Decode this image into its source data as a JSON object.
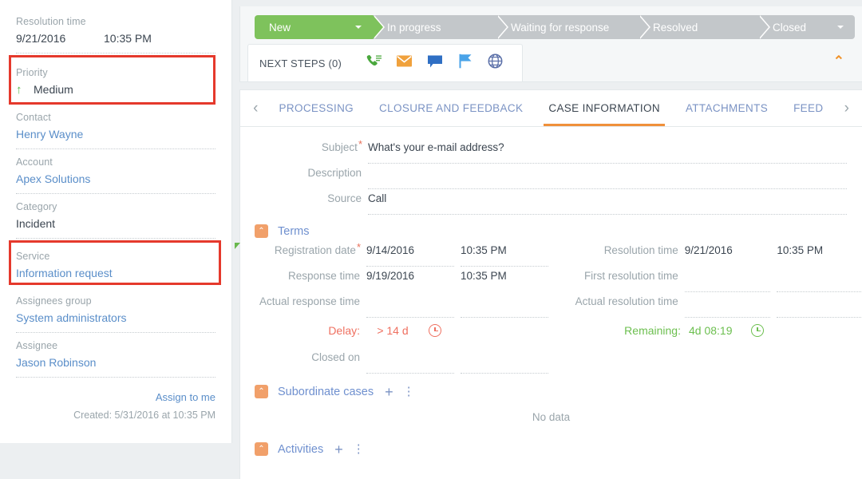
{
  "sidebar": {
    "fields": [
      {
        "label": "Resolution time",
        "value": "",
        "date": "9/21/2016",
        "time": "10:35 PM",
        "type": "datetime",
        "link": false
      },
      {
        "label": "Priority",
        "value": "Medium",
        "type": "priority",
        "arrow": "↑",
        "link": false
      },
      {
        "label": "Contact",
        "value": "Henry Wayne",
        "type": "text",
        "link": true
      },
      {
        "label": "Account",
        "value": "Apex Solutions",
        "type": "text",
        "link": true
      },
      {
        "label": "Category",
        "value": "Incident",
        "type": "text",
        "link": false
      },
      {
        "label": "Service",
        "value": "Information request",
        "type": "text",
        "link": true
      },
      {
        "label": "Assignees group",
        "value": "System administrators",
        "type": "text",
        "link": true
      },
      {
        "label": "Assignee",
        "value": "Jason Robinson",
        "type": "text",
        "link": true
      }
    ],
    "assign_to_me": "Assign to me",
    "created": "Created: 5/31/2016 at 10:35 PM"
  },
  "process": {
    "stages": [
      {
        "label": "New",
        "active": true,
        "has_caret": true
      },
      {
        "label": "In progress",
        "active": false,
        "has_caret": false
      },
      {
        "label": "Waiting for response",
        "active": false,
        "has_caret": false
      },
      {
        "label": "Resolved",
        "active": false,
        "has_caret": false
      },
      {
        "label": "Closed",
        "active": false,
        "has_caret": true
      }
    ]
  },
  "next_steps": {
    "label": "NEXT STEPS (0)",
    "icons": [
      {
        "name": "phone-call-icon",
        "glyph": "✆",
        "color": "#4aa83d"
      },
      {
        "name": "email-icon",
        "glyph": "✉",
        "color": "#f0a13c"
      },
      {
        "name": "chat-bubble-icon",
        "glyph": "■",
        "color": "#2f6fc4"
      },
      {
        "name": "flag-icon",
        "glyph": "⚑",
        "color": "#4aa3e8"
      },
      {
        "name": "globe-icon",
        "glyph": "⊕",
        "color": "#5a6fa8"
      }
    ],
    "collapse_glyph": "⌃"
  },
  "tabs": {
    "prev_glyph": "‹",
    "next_glyph": "›",
    "items": [
      {
        "label": "PROCESSING",
        "active": false
      },
      {
        "label": "CLOSURE AND FEEDBACK",
        "active": false
      },
      {
        "label": "CASE INFORMATION",
        "active": true
      },
      {
        "label": "ATTACHMENTS",
        "active": false
      },
      {
        "label": "FEED",
        "active": false
      }
    ]
  },
  "case_information": {
    "top_fields": [
      {
        "label": "Subject",
        "value": "What's your e-mail address?",
        "required": true
      },
      {
        "label": "Description",
        "value": "",
        "required": false
      },
      {
        "label": "Source",
        "value": "Call",
        "required": false
      }
    ],
    "terms": {
      "title": "Terms",
      "toggle_glyph": "⌃",
      "left": [
        {
          "label": "Registration date",
          "date": "9/14/2016",
          "time": "10:35 PM",
          "required": true,
          "green_flag": true
        },
        {
          "label": "Response time",
          "date": "9/19/2016",
          "time": "10:35 PM",
          "required": false,
          "green_flag": false
        },
        {
          "label": "Actual response time",
          "date": "",
          "time": "",
          "required": false,
          "green_flag": false
        }
      ],
      "right": [
        {
          "label": "Resolution time",
          "date": "9/21/2016",
          "time": "10:35 PM",
          "required": false,
          "green_flag": false
        },
        {
          "label": "First resolution time",
          "date": "",
          "time": "",
          "required": false,
          "green_flag": false
        },
        {
          "label": "Actual resolution time",
          "date": "",
          "time": "",
          "required": false,
          "green_flag": false
        }
      ],
      "delay_label": "Delay:",
      "delay_value": "> 14 d",
      "remaining_label": "Remaining:",
      "remaining_value": "4d 08:19",
      "closed_on_label": "Closed on"
    },
    "subordinate_cases": {
      "title": "Subordinate cases",
      "toggle_glyph": "⌃",
      "add_glyph": "+",
      "menu_glyph": "⋮",
      "empty_text": "No data"
    },
    "activities": {
      "title": "Activities",
      "toggle_glyph": "⌃",
      "add_glyph": "+",
      "menu_glyph": "⋮"
    }
  },
  "colors": {
    "highlight_red": "#e5392c",
    "stage_active_green": "#7ec25c",
    "stage_inactive_grey": "#c3c7ca",
    "accent_orange": "#f0903a",
    "link_blue": "#5a8ec9",
    "tab_blue": "#7b93c4",
    "delay_red": "#ef7060",
    "remaining_green": "#6cbf4f"
  }
}
